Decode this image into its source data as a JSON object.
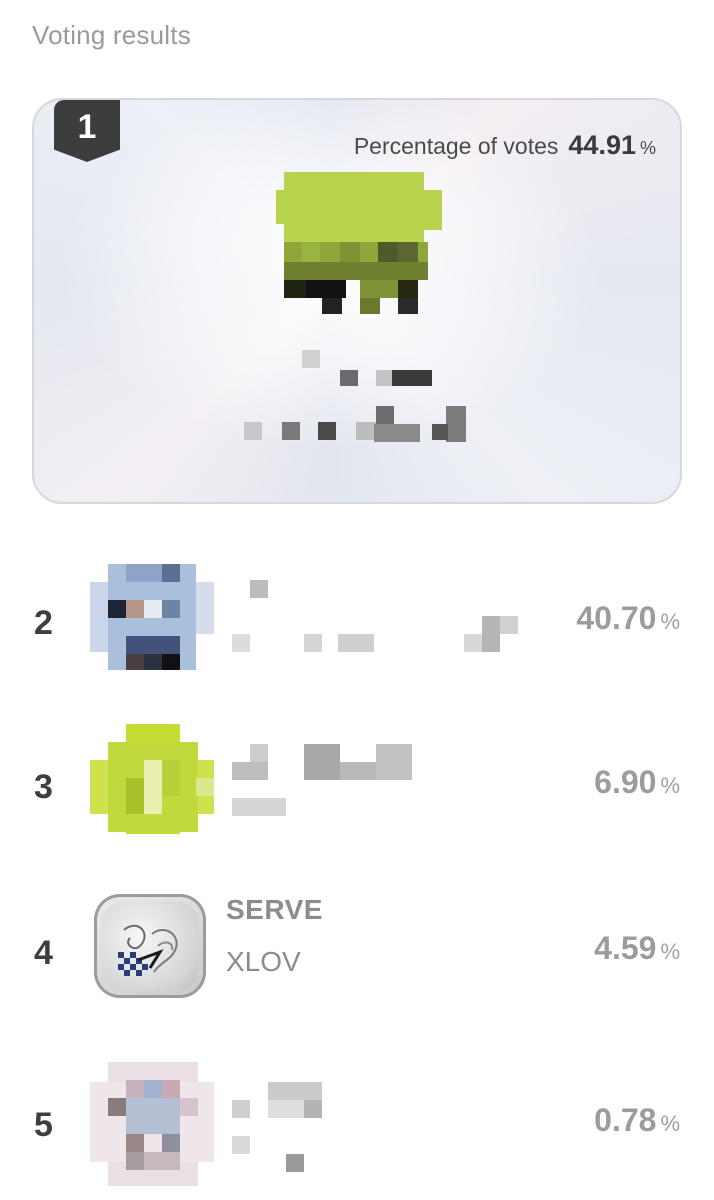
{
  "header": {
    "title": "Voting results"
  },
  "winner": {
    "rank": "1",
    "caption": "Percentage of votes",
    "value": "44.91",
    "unit": "%"
  },
  "rows": [
    {
      "rank": "2",
      "title": "",
      "artist": "",
      "value": "40.70",
      "unit": "%"
    },
    {
      "rank": "3",
      "title": "",
      "artist": "",
      "value": "6.90",
      "unit": "%"
    },
    {
      "rank": "4",
      "title": "SERVE",
      "artist": "XLOV",
      "value": "4.59",
      "unit": "%"
    },
    {
      "rank": "5",
      "title": "",
      "artist": "",
      "value": "0.78",
      "unit": "%"
    }
  ],
  "colors": {
    "badge": "#3d3d3d",
    "text_muted": "#9c9c9c",
    "winner_art_green": "#b9d651"
  }
}
